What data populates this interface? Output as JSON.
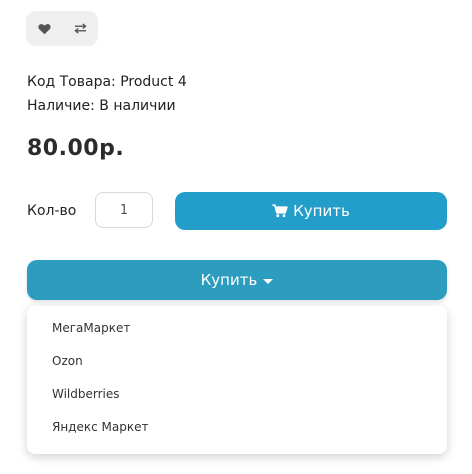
{
  "actions": {
    "wishlist_icon": "heart-icon",
    "compare_icon": "compare-arrows-icon"
  },
  "product": {
    "code_label": "Код Товара: Product 4",
    "stock_label": "Наличие: В наличии",
    "price": "80.00р."
  },
  "purchase": {
    "qty_label": "Кол-во",
    "qty_value": "1",
    "buy_label": "Купить",
    "buy_icon": "cart-icon"
  },
  "marketplace": {
    "dropdown_label": "Купить",
    "options": [
      "МегаМаркет",
      "Ozon",
      "Wildberries",
      "Яндекс Маркет"
    ]
  },
  "colors": {
    "accent": "#239dca",
    "dropdown": "#2c9dbf"
  }
}
